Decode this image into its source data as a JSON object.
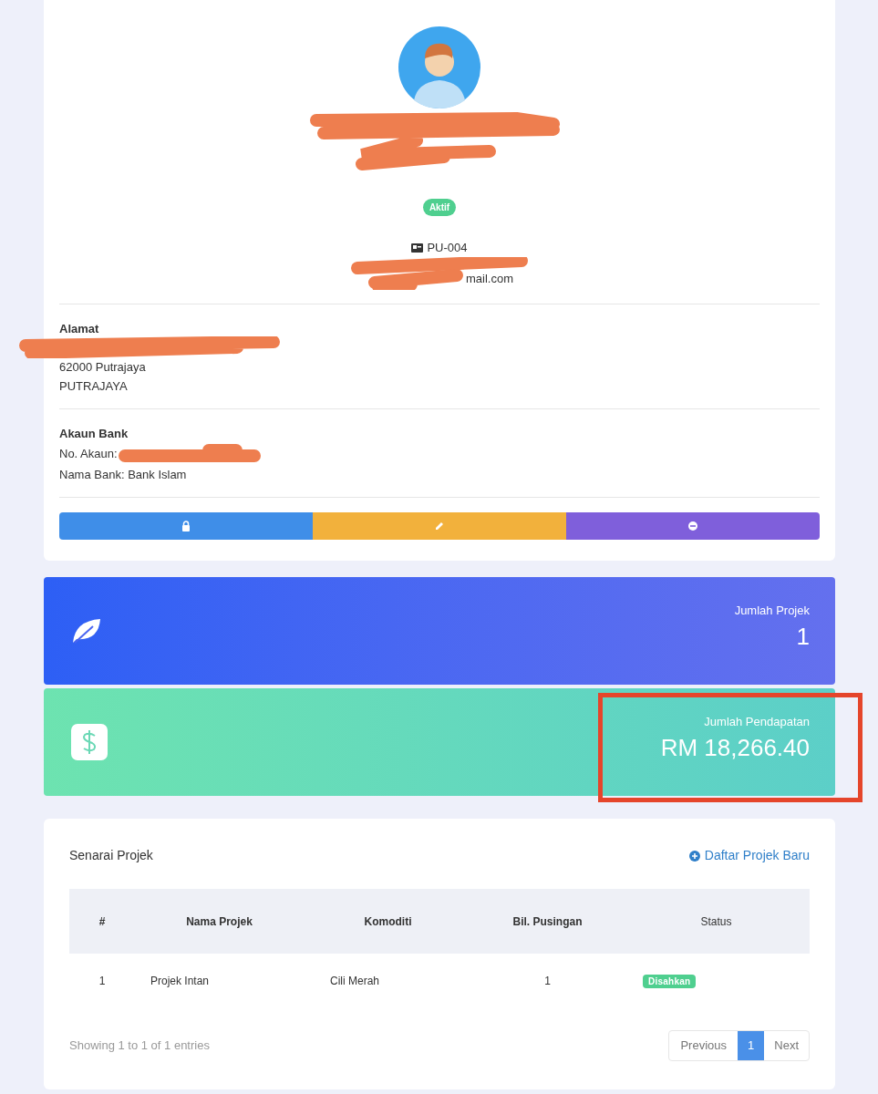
{
  "profile": {
    "name_redacted": true,
    "status": "Aktif",
    "id": "PU-004",
    "phone_redacted": true,
    "email": {
      "visible": "mail.com",
      "redacted": true
    },
    "address": {
      "heading": "Alamat",
      "line1_redacted": true,
      "lines": [
        "62000 Putrajaya",
        "PUTRAJAYA"
      ]
    },
    "bank": {
      "heading": "Akaun Bank",
      "account_label": "No. Akaun:",
      "account_redacted": true,
      "bank_line": "Nama Bank: Bank Islam"
    },
    "actions": [
      {
        "kind": "lock",
        "color": "#3f8ee8"
      },
      {
        "kind": "edit",
        "color": "#f2b13c"
      },
      {
        "kind": "remove",
        "color": "#7f5fdb"
      }
    ]
  },
  "stats": [
    {
      "kind": "leaf",
      "label": "Jumlah Projek",
      "value": "1",
      "highlighted": false
    },
    {
      "kind": "money",
      "label": "Jumlah Pendapatan",
      "value": "RM 18,266.40",
      "highlighted": true
    }
  ],
  "projects": {
    "title": "Senarai Projek",
    "add_link": "Daftar Projek Baru",
    "columns": [
      "#",
      "Nama Projek",
      "Komoditi",
      "Bil. Pusingan",
      "Status"
    ],
    "rows": [
      {
        "cells": [
          "1",
          "Projek Intan",
          "Cili Merah",
          "1"
        ],
        "status": "Disahkan"
      }
    ],
    "info": "Showing 1 to 1 of 1 entries",
    "pagination": {
      "previous": "Previous",
      "pages": [
        {
          "label": "1",
          "selected": true
        }
      ],
      "next": "Next"
    }
  }
}
